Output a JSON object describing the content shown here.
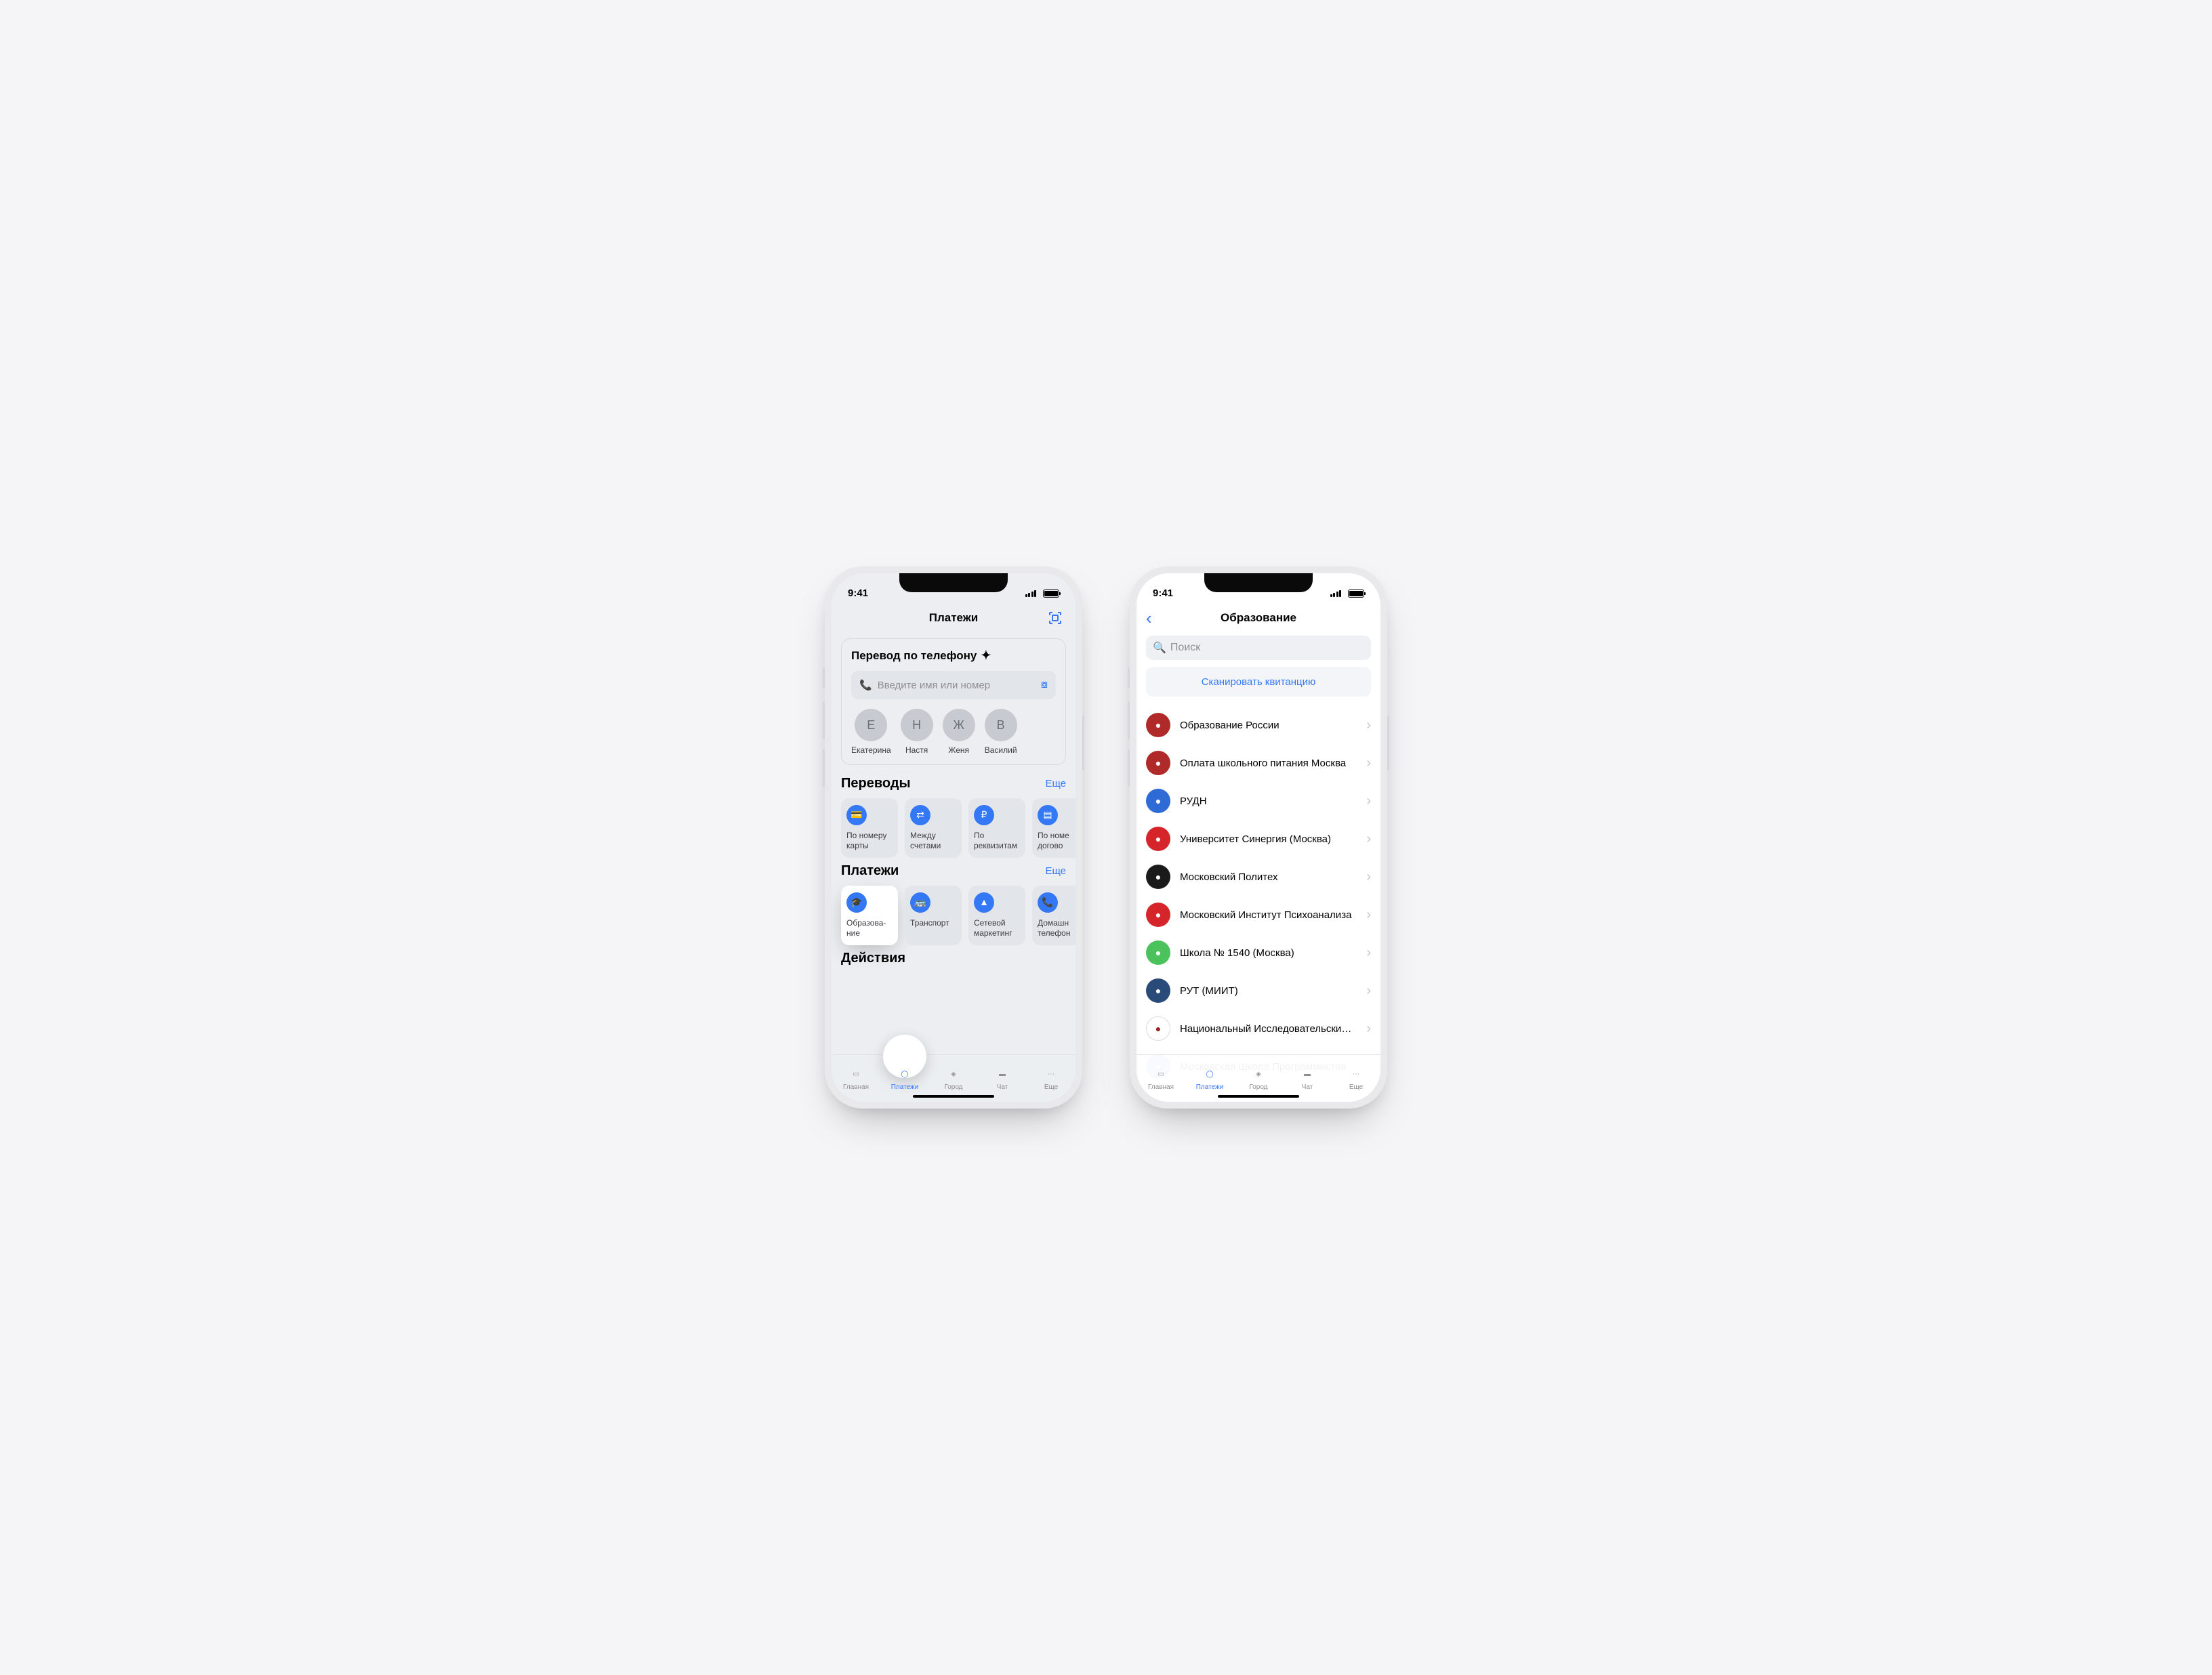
{
  "common": {
    "time": "9:41"
  },
  "tabs": [
    "Главная",
    "Платежи",
    "Город",
    "Чат",
    "Еще"
  ],
  "phone1": {
    "title": "Платежи",
    "transferByPhone": "Перевод по телефону",
    "inputPlaceholder": "Введите имя или номер",
    "contacts": [
      {
        "initial": "Е",
        "name": "Екатерина"
      },
      {
        "initial": "Н",
        "name": "Настя"
      },
      {
        "initial": "Ж",
        "name": "Женя"
      },
      {
        "initial": "В",
        "name": "Василий"
      }
    ],
    "transfers": {
      "title": "Переводы",
      "more": "Еще",
      "items": [
        "По номеру карты",
        "Между счетами",
        "По реквизитам",
        "По номе догово"
      ]
    },
    "payments": {
      "title": "Платежи",
      "more": "Еще",
      "items": [
        "Образова-\nние",
        "Транспорт",
        "Сетевой маркетинг",
        "Домашн телефон"
      ]
    },
    "actions": "Действия"
  },
  "phone2": {
    "title": "Образование",
    "searchPlaceholder": "Поиск",
    "scan": "Сканировать квитанцию",
    "orgs": [
      {
        "name": "Образование России",
        "bg": "#b02a2a"
      },
      {
        "name": "Оплата школьного питания Москва",
        "bg": "#b02a2a"
      },
      {
        "name": "РУДН",
        "bg": "#2f6bd6"
      },
      {
        "name": "Университет Синергия (Москва)",
        "bg": "#d5252a"
      },
      {
        "name": "Московский Политех",
        "bg": "#1a1a1a"
      },
      {
        "name": "Московский Институт Психоанализа",
        "bg": "#d5252a"
      },
      {
        "name": "Школа № 1540 (Москва)",
        "bg": "#4cc25d"
      },
      {
        "name": "РУТ (МИИТ)",
        "bg": "#2a4a7a"
      },
      {
        "name": "Национальный Исследовательский Университет",
        "bg": "#ffffff",
        "fg": "#9a1f1f"
      },
      {
        "name": "Московская Школа Программистов",
        "bg": "#7e9cf0"
      }
    ]
  }
}
